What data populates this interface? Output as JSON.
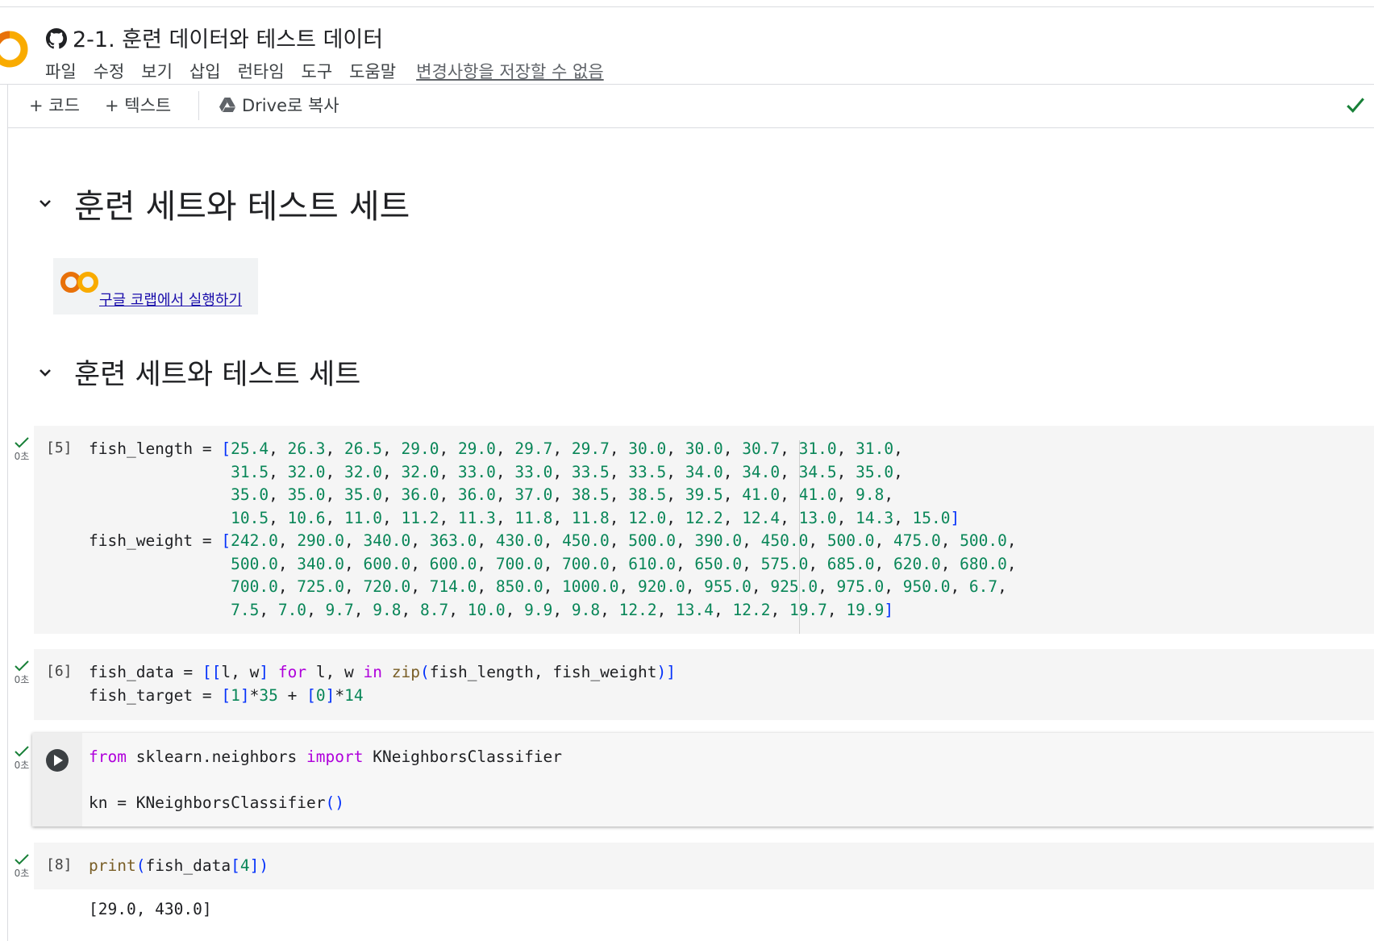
{
  "header": {
    "title": "2-1. 훈련 데이터와 테스트 데이터",
    "menu": [
      "파일",
      "수정",
      "보기",
      "삽입",
      "런타임",
      "도구",
      "도움말"
    ],
    "unsaved": "변경사항을 저장할 수 없음"
  },
  "toolbar": {
    "add_code": "+ 코드",
    "add_text": "+ 텍스트",
    "copy_drive": "Drive로 복사"
  },
  "sections": [
    {
      "title": "훈련 세트와 테스트 세트"
    },
    {
      "title": "훈련 세트와 테스트 세트"
    }
  ],
  "badge": {
    "link": "구글 코랩에서 실행하기"
  },
  "cells": [
    {
      "count": "[5]",
      "time": "0초"
    },
    {
      "count": "[6]",
      "time": "0초"
    },
    {
      "count": "",
      "time": "0초"
    },
    {
      "count": "[8]",
      "time": "0초",
      "output": "[29.0, 430.0]"
    }
  ],
  "code": {
    "fish_length": [
      "25.4",
      "26.3",
      "26.5",
      "29.0",
      "29.0",
      "29.7",
      "29.7",
      "30.0",
      "30.0",
      "30.7",
      "31.0",
      "31.0",
      "31.5",
      "32.0",
      "32.0",
      "32.0",
      "33.0",
      "33.0",
      "33.5",
      "33.5",
      "34.0",
      "34.0",
      "34.5",
      "35.0",
      "35.0",
      "35.0",
      "35.0",
      "36.0",
      "36.0",
      "37.0",
      "38.5",
      "38.5",
      "39.5",
      "41.0",
      "41.0",
      "9.8",
      "10.5",
      "10.6",
      "11.0",
      "11.2",
      "11.3",
      "11.8",
      "11.8",
      "12.0",
      "12.2",
      "12.4",
      "13.0",
      "14.3",
      "15.0"
    ],
    "fish_weight": [
      "242.0",
      "290.0",
      "340.0",
      "363.0",
      "430.0",
      "450.0",
      "500.0",
      "390.0",
      "450.0",
      "500.0",
      "475.0",
      "500.0",
      "500.0",
      "340.0",
      "600.0",
      "600.0",
      "700.0",
      "700.0",
      "610.0",
      "650.0",
      "575.0",
      "685.0",
      "620.0",
      "680.0",
      "700.0",
      "725.0",
      "720.0",
      "714.0",
      "850.0",
      "1000.0",
      "920.0",
      "955.0",
      "925.0",
      "975.0",
      "950.0",
      "6.7",
      "7.5",
      "7.0",
      "9.7",
      "9.8",
      "8.7",
      "10.0",
      "9.9",
      "9.8",
      "12.2",
      "13.4",
      "12.2",
      "19.7",
      "19.9"
    ]
  },
  "colors": {
    "number": "#098658",
    "keyword": "#af00db",
    "function": "#795e26",
    "bracket": "#0431fa",
    "ok": "#188038"
  }
}
